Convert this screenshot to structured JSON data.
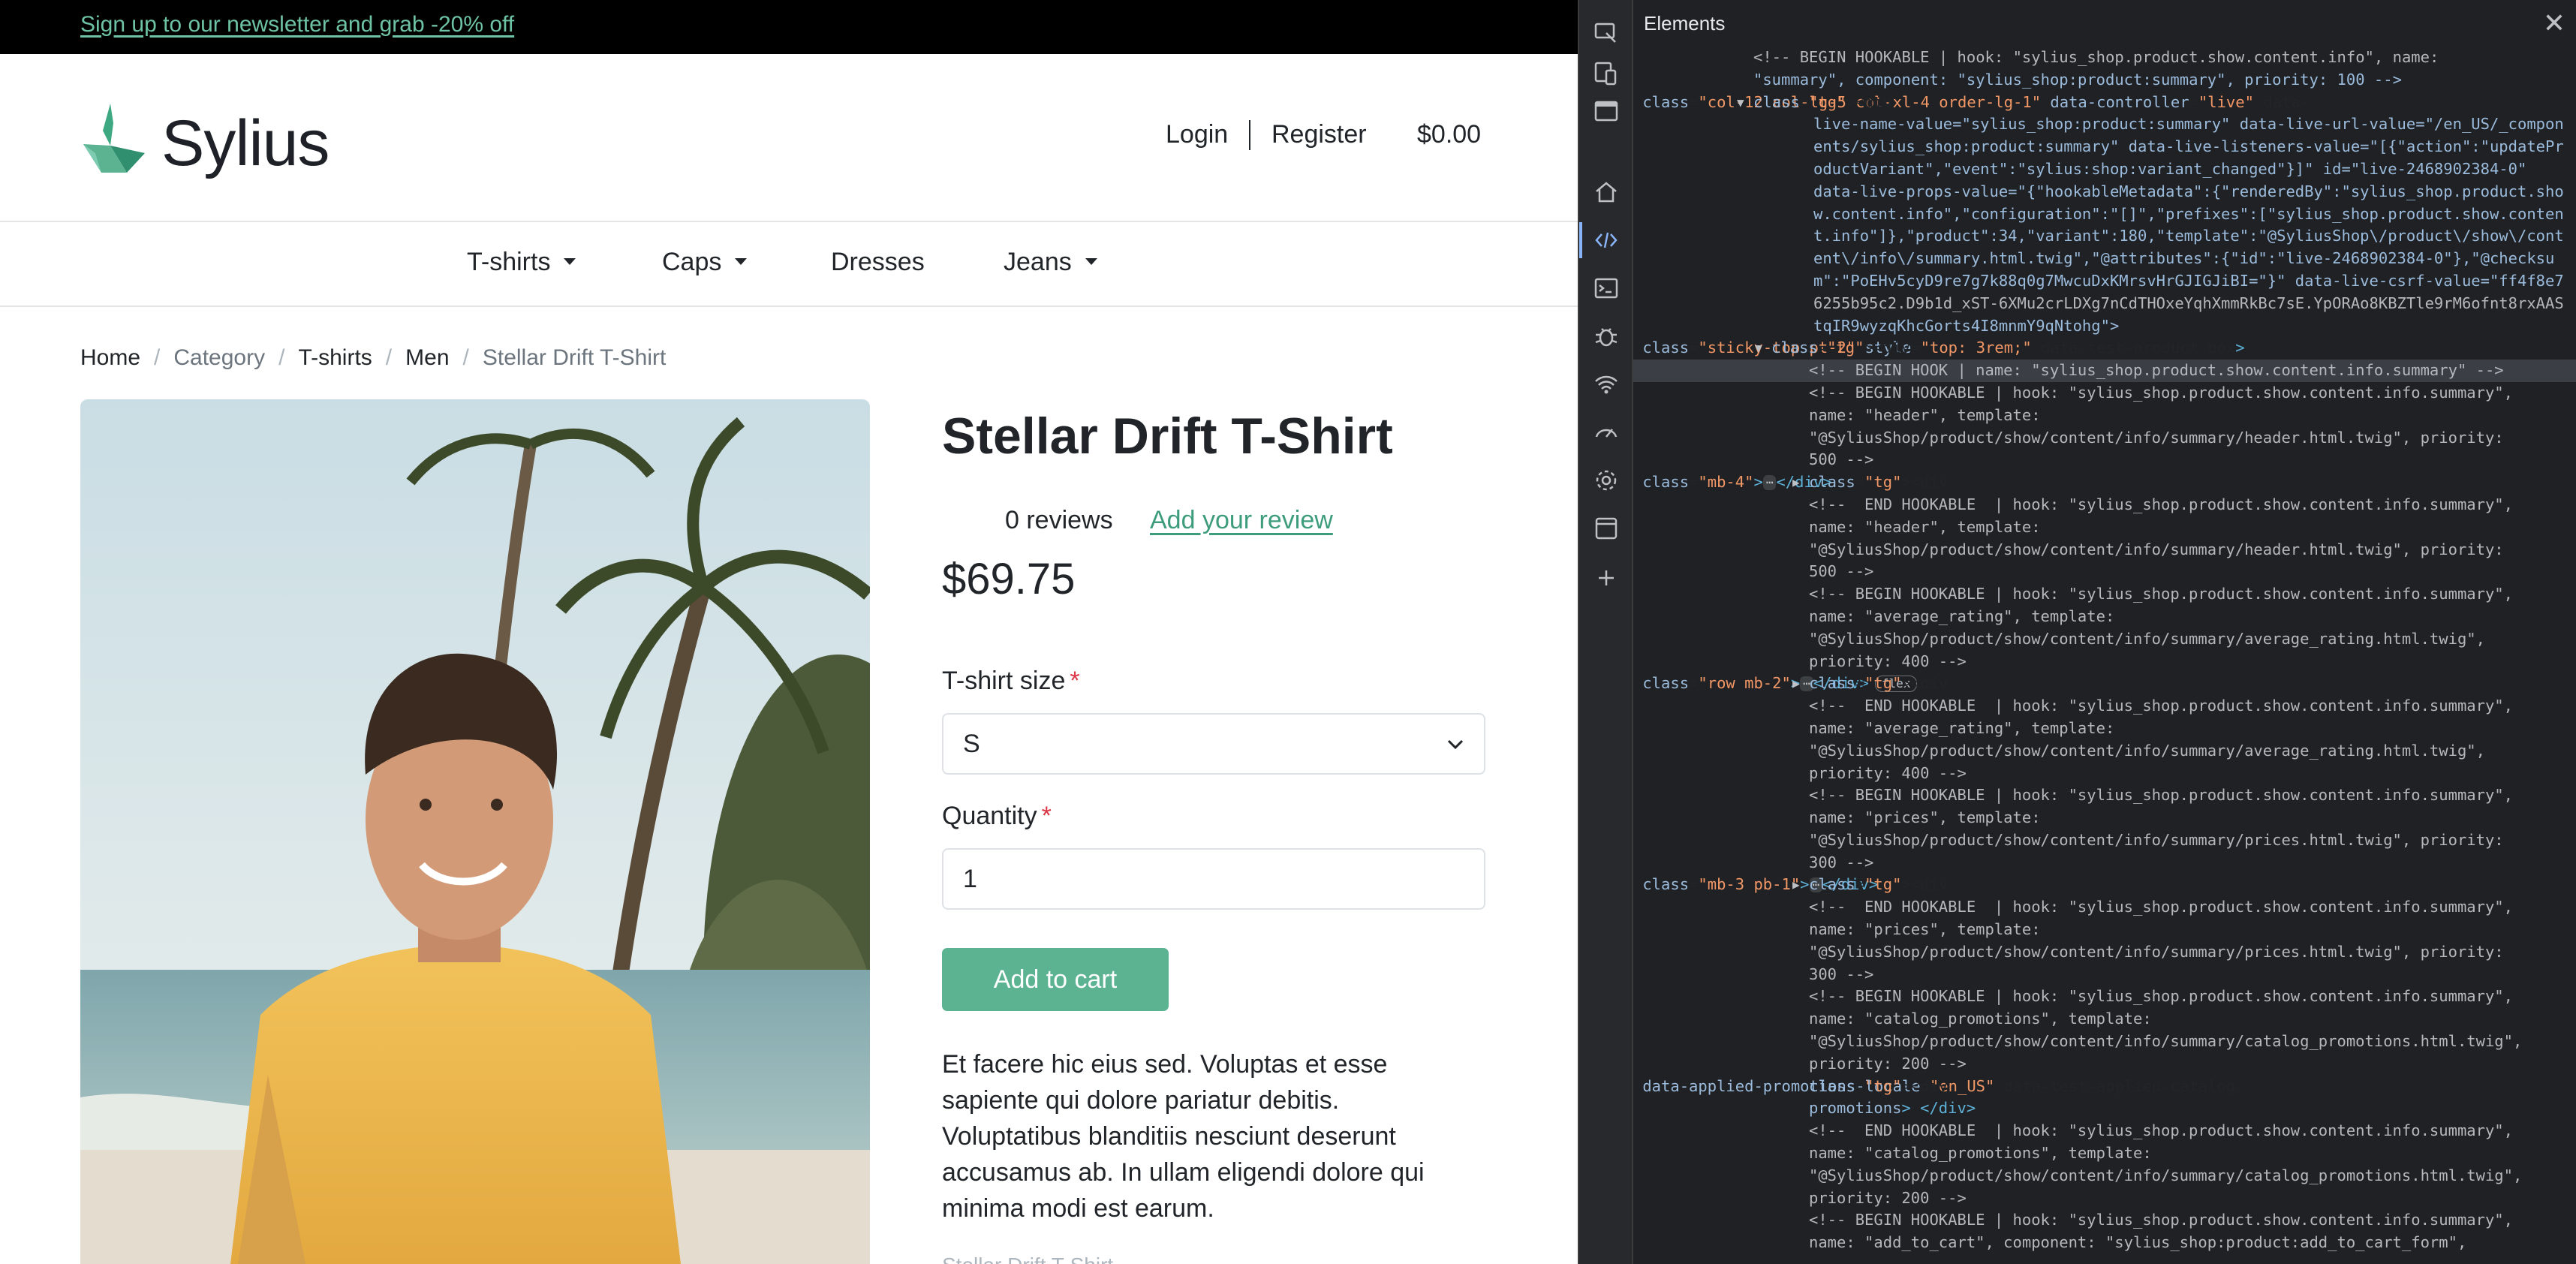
{
  "topbar": {
    "newsletter_text": "Sign up to our newsletter and grab -20% off"
  },
  "brand": {
    "name": "Sylius",
    "accent": "#5cb392",
    "logo_icon": "sylius-swan-logo"
  },
  "header": {
    "login": "Login",
    "register": "Register",
    "cart_total": "$0.00"
  },
  "nav": {
    "items": [
      {
        "label": "T-shirts",
        "has_dropdown": true
      },
      {
        "label": "Caps",
        "has_dropdown": true
      },
      {
        "label": "Dresses",
        "has_dropdown": false
      },
      {
        "label": "Jeans",
        "has_dropdown": true
      }
    ]
  },
  "breadcrumb": {
    "home": "Home",
    "category": "Category",
    "tshirts": "T-shirts",
    "men": "Men",
    "current": "Stellar Drift T-Shirt"
  },
  "product": {
    "title": "Stellar Drift T-Shirt",
    "reviews": "0 reviews",
    "add_review": "Add your review",
    "price": "$69.75",
    "size_label": "T-shirt size",
    "size_value": "S",
    "quantity_label": "Quantity",
    "quantity_value": "1",
    "required_mark": "*",
    "add_to_cart": "Add to cart",
    "description": "Et facere hic eius sed. Voluptas et esse sapiente qui dolore pariatur debitis. Voluptatibus blanditiis nesciunt deserunt accusamus ab. In ullam eligendi dolore qui minima modi est earum.",
    "trailing_text": "Stellar Drift T-Shirt"
  },
  "devtools": {
    "panel_title": "Elements",
    "close_icon": "close-icon",
    "rail_icons": [
      "inspect-icon",
      "device-toolbar-icon",
      "dock-icon",
      "home-icon",
      "elements-icon",
      "console-icon",
      "sources-icon",
      "network-icon",
      "performance-icon",
      "settings-icon",
      "application-icon",
      "add-panel-icon"
    ],
    "colors": {
      "comment": "#b4b8bd",
      "tag": "#5db0d7",
      "attr_name": "#9bbbdc",
      "attr_value": "#f29766",
      "selected_row": "#3b3f45"
    }
  },
  "dom_lines": [
    {
      "t": "<!-- BEGIN HOOKABLE | hook: \"sylius_shop.product.show.content.info\", name:"
    },
    {
      "t": "\"summary\", component: \"sylius_shop:product:summary\", priority: 100 -->"
    },
    {
      "t": "<div class=\"col-12 col-lg-5 col-xl-4 order-lg-1\" data-controller=\"live\" data-"
    },
    {
      "t": "live-name-value=\"sylius_shop:product:summary\" data-live-url-value=\"/en_US/_compon"
    },
    {
      "t": "ents/sylius_shop:product:summary\" data-live-listeners-value=\"[{\"action\":\"updatePr"
    },
    {
      "t": "oductVariant\",\"event\":\"sylius:shop:variant_changed\"}]\" id=\"live-2468902384-0\""
    },
    {
      "t": "data-live-props-value=\"{\"hookableMetadata\":{\"renderedBy\":\"sylius_shop.product.sho"
    },
    {
      "t": "w.content.info\",\"configuration\":\"[]\",\"prefixes\":[\"sylius_shop.product.show.conten"
    },
    {
      "t": "t.info\"]},\"product\":34,\"variant\":180,\"template\":\"@SyliusShop\\/product\\/show\\/cont"
    },
    {
      "t": "ent\\/info\\/summary.html.twig\",\"@attributes\":{\"id\":\"live-2468902384-0\"},\"@checksu"
    },
    {
      "t": "m\":\"PoEHv5cyD9re7g7k88q0g7MwcuDxKMrsvHrGJIGJiBI=\"}\" data-live-csrf-value=\"ff4f8e7"
    },
    {
      "t": "6255b95c2.D9b1d_xST-6XMu2crLDXg7nCdTHOxeYqhXmmRkBc7sE.YpORAo8KBZTle9rM6ofnt8rxAAS"
    },
    {
      "t": "tqIR9wyzqKhcGorts4I8mnmY9qNtohg\">"
    },
    {
      "t": "<div class=\"sticky-top pt-2\" style=\"top: 3rem;\" data-test-product-box>"
    },
    {
      "t": "<!-- BEGIN HOOK | name: \"sylius_shop.product.show.content.info.summary\" -->"
    },
    {
      "t": "<!-- BEGIN HOOKABLE | hook: \"sylius_shop.product.show.content.info.summary\","
    },
    {
      "t": "name: \"header\", template:"
    },
    {
      "t": "\"@SyliusShop/product/show/content/info/summary/header.html.twig\", priority:"
    },
    {
      "t": "500 -->"
    },
    {
      "t": "<div class=\"mb-4\">"
    },
    {
      "t": "<!--  END HOOKABLE  | hook: \"sylius_shop.product.show.content.info.summary\","
    },
    {
      "t": "name: \"header\", template:"
    },
    {
      "t": "\"@SyliusShop/product/show/content/info/summary/header.html.twig\", priority:"
    },
    {
      "t": "500 -->"
    },
    {
      "t": "<!-- BEGIN HOOKABLE | hook: \"sylius_shop.product.show.content.info.summary\","
    },
    {
      "t": "name: \"average_rating\", template:"
    },
    {
      "t": "\"@SyliusShop/product/show/content/info/summary/average_rating.html.twig\","
    },
    {
      "t": "priority: 400 -->"
    },
    {
      "t": "<div class=\"row mb-2\">"
    },
    {
      "t": "<!--  END HOOKABLE  | hook: \"sylius_shop.product.show.content.info.summary\","
    },
    {
      "t": "name: \"average_rating\", template:"
    },
    {
      "t": "\"@SyliusShop/product/show/content/info/summary/average_rating.html.twig\","
    },
    {
      "t": "priority: 400 -->"
    },
    {
      "t": "<!-- BEGIN HOOKABLE | hook: \"sylius_shop.product.show.content.info.summary\","
    },
    {
      "t": "name: \"prices\", template:"
    },
    {
      "t": "\"@SyliusShop/product/show/content/info/summary/prices.html.twig\", priority:"
    },
    {
      "t": "300 -->"
    },
    {
      "t": "<div class=\"mb-3 pb-1\">"
    },
    {
      "t": "<!--  END HOOKABLE  | hook: \"sylius_shop.product.show.content.info.summary\","
    },
    {
      "t": "name: \"prices\", template:"
    },
    {
      "t": "\"@SyliusShop/product/show/content/info/summary/prices.html.twig\", priority:"
    },
    {
      "t": "300 -->"
    },
    {
      "t": "<!-- BEGIN HOOKABLE | hook: \"sylius_shop.product.show.content.info.summary\","
    },
    {
      "t": "name: \"catalog_promotions\", template:"
    },
    {
      "t": "\"@SyliusShop/product/show/content/info/summary/catalog_promotions.html.twig\","
    },
    {
      "t": "priority: 200 -->"
    },
    {
      "t": "<div data-applied-promotions-locale=\"en_US\" data-test-applied-catalog-"
    },
    {
      "t": "promotions> </div>"
    },
    {
      "t": "<!--  END HOOKABLE  | hook: \"sylius_shop.product.show.content.info.summary\","
    },
    {
      "t": "name: \"catalog_promotions\", template:"
    },
    {
      "t": "\"@SyliusShop/product/show/content/info/summary/catalog_promotions.html.twig\","
    },
    {
      "t": "priority: 200 -->"
    },
    {
      "t": "<!-- BEGIN HOOKABLE | hook: \"sylius_shop.product.show.content.info.summary\","
    },
    {
      "t": "name: \"add_to_cart\", component: \"sylius_shop:product:add_to_cart_form\","
    }
  ]
}
